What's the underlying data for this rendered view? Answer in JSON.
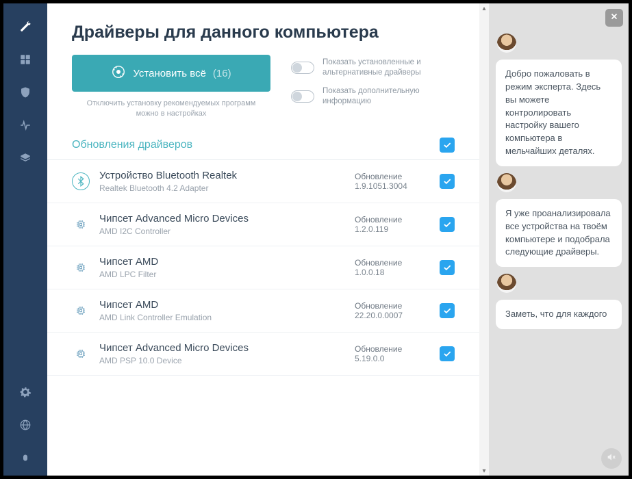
{
  "header": {
    "title": "Драйверы для данного компьютера"
  },
  "install": {
    "label": "Установить всё",
    "count": "(16)",
    "hint": "Отключить установку рекомендуемых программ можно в настройках"
  },
  "toggles": {
    "t1": "Показать установленные и альтернативные драйверы",
    "t2": "Показать дополнительную информацию"
  },
  "section": {
    "title": "Обновления драйверов"
  },
  "drivers": [
    {
      "name": "Устройство Bluetooth Realtek",
      "sub": "Realtek Bluetooth 4.2 Adapter",
      "upd": "Обновление",
      "ver": "1.9.1051.3004",
      "icon": "bt"
    },
    {
      "name": "Чипсет Advanced Micro Devices",
      "sub": "AMD I2C Controller",
      "upd": "Обновление",
      "ver": "1.2.0.119",
      "icon": "chip"
    },
    {
      "name": "Чипсет AMD",
      "sub": "AMD LPC Filter",
      "upd": "Обновление",
      "ver": "1.0.0.18",
      "icon": "chip"
    },
    {
      "name": "Чипсет AMD",
      "sub": "AMD Link Controller Emulation",
      "upd": "Обновление",
      "ver": "22.20.0.0007",
      "icon": "chip"
    },
    {
      "name": "Чипсет Advanced Micro Devices",
      "sub": "AMD PSP 10.0 Device",
      "upd": "Обновление",
      "ver": "5.19.0.0",
      "icon": "chip"
    }
  ],
  "chat": {
    "m1": "Добро пожаловать в режим эксперта. Здесь вы можете контролировать настройку вашего компьютера в мельчайших деталях.",
    "m2": "Я уже проанализировала все устройства на твоём компьютере и подобрала следующие драйверы.",
    "m3": "Заметь, что для каждого"
  }
}
